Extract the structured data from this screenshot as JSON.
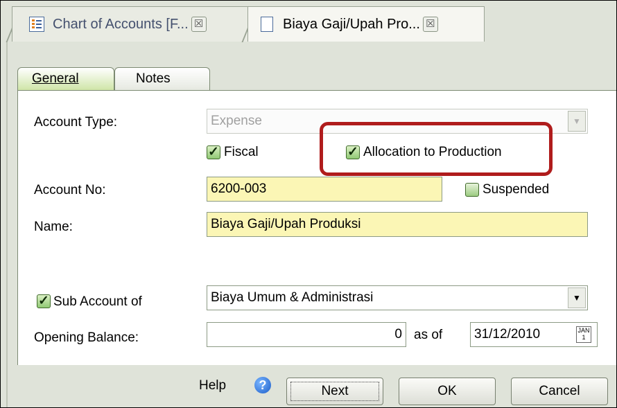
{
  "tabs": [
    {
      "label": "Chart of Accounts [F...",
      "icon": "list-icon",
      "close": "☒"
    },
    {
      "label": "Biaya Gaji/Upah Pro...",
      "icon": "document-icon",
      "close": "☒"
    }
  ],
  "page_tabs": {
    "general": "General",
    "notes": "Notes"
  },
  "form": {
    "account_type_label": "Account Type:",
    "account_type_value": "Expense",
    "fiscal_label": "Fiscal",
    "allocation_label": "Allocation to Production",
    "account_no_label": "Account No:",
    "account_no_value": "6200-003",
    "suspended_label": "Suspended",
    "name_label": "Name:",
    "name_value": "Biaya Gaji/Upah Produksi",
    "sub_account_label": "Sub Account of",
    "sub_account_value": "Biaya Umum & Administrasi",
    "opening_balance_label": "Opening Balance:",
    "opening_balance_value": "0",
    "as_of_label": "as of",
    "as_of_value": "31/12/2010"
  },
  "checks": {
    "fiscal": true,
    "allocation": true,
    "suspended": false,
    "sub_account": true
  },
  "buttons": {
    "help": "Help",
    "help_icon": "?",
    "next": "Next",
    "ok": "OK",
    "cancel": "Cancel"
  },
  "colors": {
    "highlight": "#b01c1c",
    "field_yellow": "#fbf6b5",
    "frame": "#dfe3d9"
  }
}
